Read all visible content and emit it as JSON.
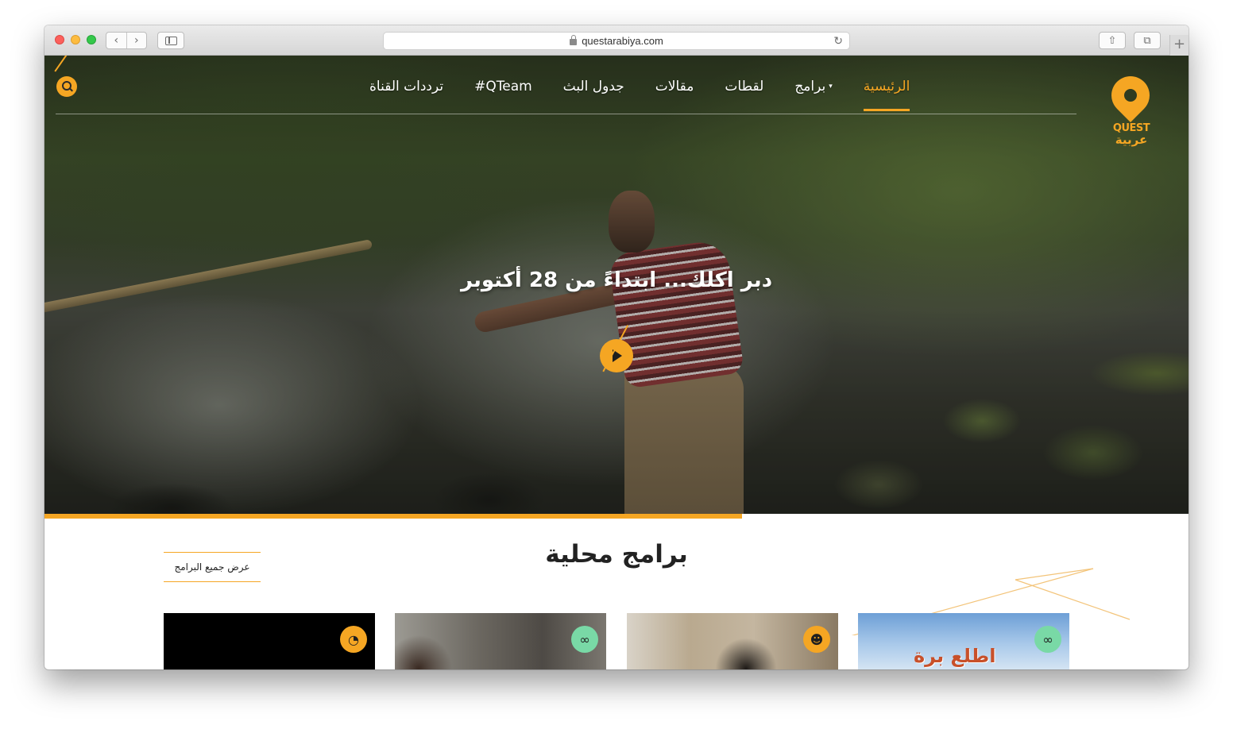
{
  "browser": {
    "url": "questarabiya.com",
    "back_icon": "‹",
    "forward_icon": "›",
    "reload_icon": "↻",
    "share_icon": "⇧",
    "tabs_icon": "⧉",
    "newtab_icon": "+"
  },
  "site": {
    "logo_en": "QUEST",
    "logo_ar": "عربية",
    "nav": [
      {
        "label": "الرئيسية",
        "active": true
      },
      {
        "label": "برامج",
        "has_dropdown": true
      },
      {
        "label": "لقطات"
      },
      {
        "label": "مقالات"
      },
      {
        "label": "جدول البث"
      },
      {
        "label": "#QTeam"
      },
      {
        "label": "ترددات القناة"
      }
    ],
    "nav_caret": "▾",
    "accent_color": "#f5a623"
  },
  "hero": {
    "title": "دبر اكلك... ابتداءً من 28 أكتوبر",
    "progress_percent": 61
  },
  "section": {
    "title": "برامج محلية",
    "view_all_label": "عرض جميع البرامج",
    "cards": [
      {
        "badge_icon": "gauge-icon",
        "badge_glyph": "◔",
        "badge_color": "#f5a623"
      },
      {
        "badge_icon": "binoculars-icon",
        "badge_glyph": "∞",
        "badge_color": "#79d9a6"
      },
      {
        "badge_icon": "beard-face-icon",
        "badge_glyph": "☻",
        "badge_color": "#f5a623"
      },
      {
        "badge_icon": "binoculars-icon",
        "badge_glyph": "∞",
        "badge_color": "#79d9a6",
        "art_text": "اطلع برة"
      }
    ]
  }
}
